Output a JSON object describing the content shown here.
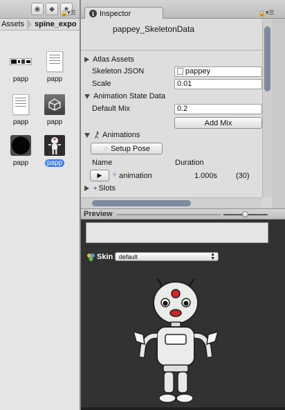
{
  "project": {
    "breadcrumb": [
      "Assets",
      "spine_expo"
    ],
    "assets": [
      {
        "label": "papp",
        "kind": "atlas-icon"
      },
      {
        "label": "papp",
        "kind": "text-doc-icon"
      },
      {
        "label": "papp",
        "kind": "text-doc-icon"
      },
      {
        "label": "papp",
        "kind": "unity-material-icon"
      },
      {
        "label": "papp",
        "kind": "black-circle-texture-icon"
      },
      {
        "label": "papp",
        "kind": "robot-skeleton-data-icon",
        "selected": true
      }
    ]
  },
  "inspector": {
    "tab_label": "Inspector",
    "title": "pappey_SkeletonData",
    "atlas_assets_label": "Atlas Assets",
    "skeleton_json_label": "Skeleton JSON",
    "skeleton_json_value": "pappey",
    "scale_label": "Scale",
    "scale_value": "0.01",
    "anim_state_label": "Animation State Data",
    "default_mix_label": "Default Mix",
    "default_mix_value": "0.2",
    "add_mix_label": "Add Mix",
    "animations_label": "Animations",
    "setup_pose_label": "Setup Pose",
    "col_name": "Name",
    "col_duration": "Duration",
    "animation_name": "animation",
    "animation_duration": "1.000s",
    "animation_frames": "(30)",
    "slots_label": "Slots"
  },
  "preview": {
    "label": "Preview",
    "skin_label": "Skin",
    "skin_value": "default"
  },
  "colors": {
    "selection": "#3f7fe0",
    "scroll_thumb": "#7e8aa0",
    "preview_bg": "#323232"
  }
}
